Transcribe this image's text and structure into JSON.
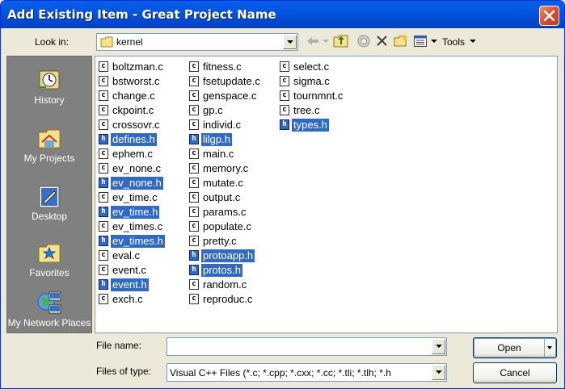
{
  "window": {
    "title": "Add Existing Item - Great Project Name"
  },
  "look_in": {
    "label": "Look in:",
    "value": "kernel"
  },
  "toolbar": {
    "tools_label": "Tools"
  },
  "places": [
    {
      "label": "History",
      "icon": "history-icon"
    },
    {
      "label": "My Projects",
      "icon": "my-projects-icon"
    },
    {
      "label": "Desktop",
      "icon": "desktop-icon"
    },
    {
      "label": "Favorites",
      "icon": "favorites-icon"
    },
    {
      "label": "My Network Places",
      "icon": "network-places-icon"
    }
  ],
  "files": {
    "col1": [
      {
        "name": "boltzman.c",
        "type": "c",
        "selected": false
      },
      {
        "name": "bstworst.c",
        "type": "c",
        "selected": false
      },
      {
        "name": "change.c",
        "type": "c",
        "selected": false
      },
      {
        "name": "ckpoint.c",
        "type": "c",
        "selected": false
      },
      {
        "name": "crossovr.c",
        "type": "c",
        "selected": false
      },
      {
        "name": "defines.h",
        "type": "h",
        "selected": true
      },
      {
        "name": "ephem.c",
        "type": "c",
        "selected": false
      },
      {
        "name": "ev_none.c",
        "type": "c",
        "selected": false
      },
      {
        "name": "ev_none.h",
        "type": "h",
        "selected": true
      },
      {
        "name": "ev_time.c",
        "type": "c",
        "selected": false
      },
      {
        "name": "ev_time.h",
        "type": "h",
        "selected": true
      },
      {
        "name": "ev_times.c",
        "type": "c",
        "selected": false
      },
      {
        "name": "ev_times.h",
        "type": "h",
        "selected": true
      },
      {
        "name": "eval.c",
        "type": "c",
        "selected": false
      },
      {
        "name": "event.c",
        "type": "c",
        "selected": false
      },
      {
        "name": "event.h",
        "type": "h",
        "selected": true
      },
      {
        "name": "exch.c",
        "type": "c",
        "selected": false
      }
    ],
    "col2": [
      {
        "name": "fitness.c",
        "type": "c",
        "selected": false
      },
      {
        "name": "fsetupdate.c",
        "type": "c",
        "selected": false
      },
      {
        "name": "genspace.c",
        "type": "c",
        "selected": false
      },
      {
        "name": "gp.c",
        "type": "c",
        "selected": false
      },
      {
        "name": "individ.c",
        "type": "c",
        "selected": false
      },
      {
        "name": "lilgp.h",
        "type": "h",
        "selected": true
      },
      {
        "name": "main.c",
        "type": "c",
        "selected": false
      },
      {
        "name": "memory.c",
        "type": "c",
        "selected": false
      },
      {
        "name": "mutate.c",
        "type": "c",
        "selected": false
      },
      {
        "name": "output.c",
        "type": "c",
        "selected": false
      },
      {
        "name": "params.c",
        "type": "c",
        "selected": false
      },
      {
        "name": "populate.c",
        "type": "c",
        "selected": false
      },
      {
        "name": "pretty.c",
        "type": "c",
        "selected": false
      },
      {
        "name": "protoapp.h",
        "type": "h",
        "selected": true
      },
      {
        "name": "protos.h",
        "type": "h",
        "selected": true
      },
      {
        "name": "random.c",
        "type": "c",
        "selected": false
      },
      {
        "name": "reproduc.c",
        "type": "c",
        "selected": false
      }
    ],
    "col3": [
      {
        "name": "select.c",
        "type": "c",
        "selected": false
      },
      {
        "name": "sigma.c",
        "type": "c",
        "selected": false
      },
      {
        "name": "tournmnt.c",
        "type": "c",
        "selected": false
      },
      {
        "name": "tree.c",
        "type": "c",
        "selected": false
      },
      {
        "name": "types.h",
        "type": "h",
        "selected": true
      }
    ]
  },
  "file_name": {
    "label": "File name:",
    "value": ""
  },
  "file_type": {
    "label": "Files of type:",
    "value": "Visual C++ Files (*.c; *.cpp; *.cxx; *.cc; *.tli; *.tlh; *.h"
  },
  "buttons": {
    "open": "Open",
    "cancel": "Cancel"
  },
  "colors": {
    "title_bar": "#0454e0",
    "selection": "#316ac5",
    "dialog_bg": "#ece9d8",
    "places_bar": "#808080"
  }
}
